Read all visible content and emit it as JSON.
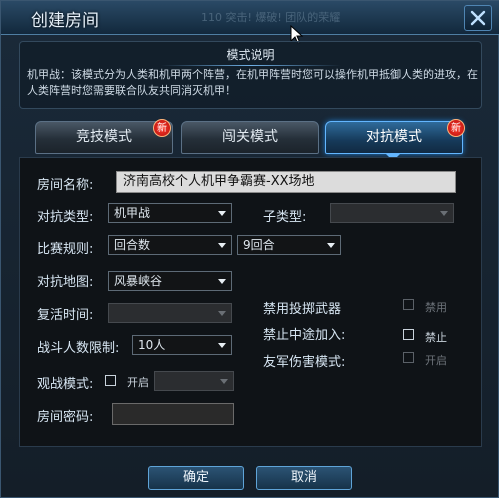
{
  "window": {
    "title": "创建房间",
    "background_text": "110 突击! 爆破! 团队的荣耀",
    "close_icon": "close-icon"
  },
  "description": {
    "header": "模式说明",
    "text": "机甲战：该模式分为人类和机甲两个阵营，在机甲阵营时您可以操作机甲抵御人类的进攻，在人类阵营时您需要联合队友共同消灭机甲！"
  },
  "tabs": [
    {
      "label": "竞技模式",
      "badge": "新",
      "active": false
    },
    {
      "label": "闯关模式",
      "badge": "",
      "active": false
    },
    {
      "label": "对抗模式",
      "badge": "新",
      "active": true
    }
  ],
  "form": {
    "room_name_label": "房间名称:",
    "room_name_value": "济南高校个人机甲争霸赛-XX场地",
    "battle_type_label": "对抗类型:",
    "battle_type_value": "机甲战",
    "subtype_label": "子类型:",
    "subtype_value": "",
    "rule_label": "比赛规则:",
    "rule_value": "回合数",
    "rounds_value": "9回合",
    "map_label": "对抗地图:",
    "map_value": "风暴峡谷",
    "revive_label": "复活时间:",
    "revive_value": "",
    "players_label": "战斗人数限制:",
    "players_value": "10人",
    "spectate_label": "观战模式:",
    "spectate_option": "开启",
    "spectate_value": "",
    "password_label": "房间密码:",
    "no_throw_label": "禁用投掷武器",
    "no_throw_option": "禁用",
    "no_join_label": "禁止中途加入:",
    "no_join_option": "禁止",
    "friendly_fire_label": "友军伤害模式:",
    "friendly_fire_option": "开启"
  },
  "buttons": {
    "confirm": "确定",
    "cancel": "取消"
  },
  "colors": {
    "accent": "#63b6ff",
    "badge": "#d81f1f",
    "panel": "#0f1317"
  }
}
